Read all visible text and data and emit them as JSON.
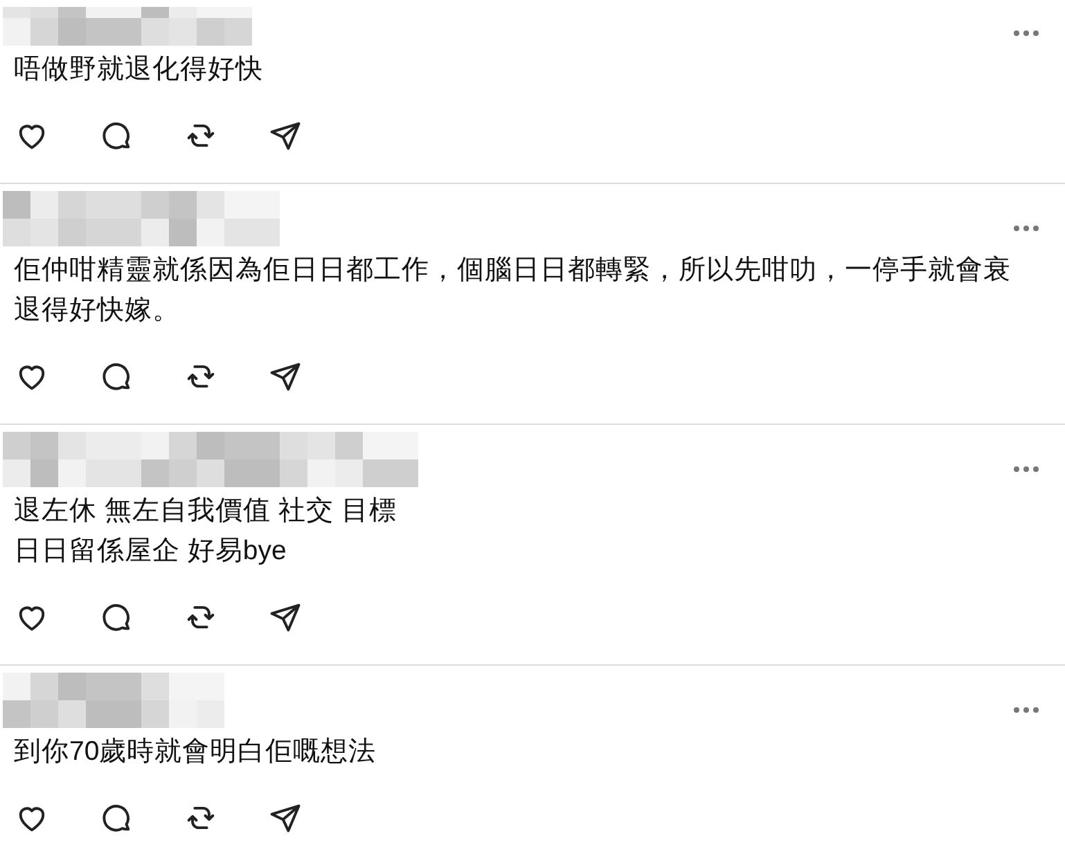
{
  "comments": [
    {
      "lines": [
        "唔做野就退化得好快"
      ]
    },
    {
      "lines": [
        "佢仲咁精靈就係因為佢日日都工作，個腦日日都轉緊，所以先咁叻，一停手就會衰退得好快嫁。"
      ]
    },
    {
      "lines": [
        "退左休 無左自我價值 社交 目標",
        "日日留係屋企 好易bye"
      ]
    },
    {
      "lines": [
        "到你70歲時就會明白佢嘅想法"
      ]
    }
  ]
}
